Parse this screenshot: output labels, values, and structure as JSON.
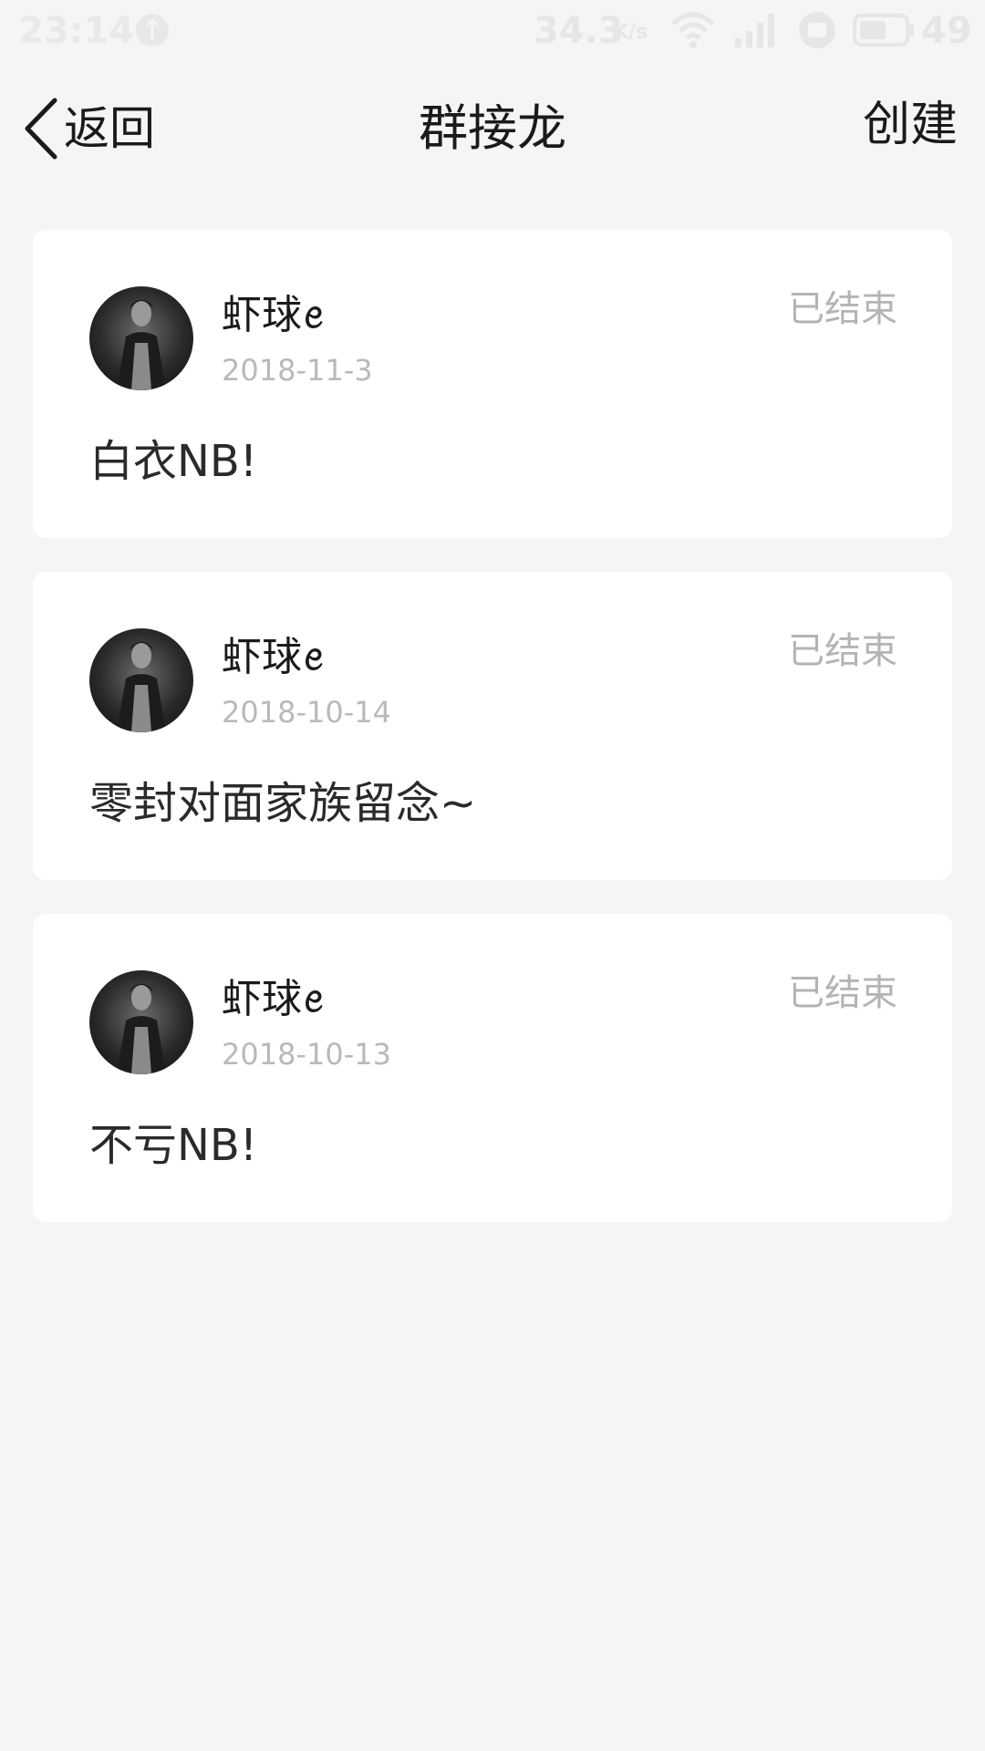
{
  "status_bar": {
    "time": "23:14",
    "network_speed": "34.3",
    "network_speed_unit": "K/s",
    "battery_level": "49",
    "icons": [
      "notification-icon",
      "wifi-icon",
      "signal-icon",
      "hd-icon",
      "battery-icon"
    ]
  },
  "nav": {
    "back_label": "返回",
    "title": "群接龙",
    "create_label": "创建"
  },
  "cards": [
    {
      "name": "虾球ꫀ",
      "date": "2018-11-3",
      "status": "已结束",
      "text": "白衣NB!"
    },
    {
      "name": "虾球ꫀ",
      "date": "2018-10-14",
      "status": "已结束",
      "text": "零封对面家族留念~"
    },
    {
      "name": "虾球ꫀ",
      "date": "2018-10-13",
      "status": "已结束",
      "text": "不亏NB!"
    }
  ],
  "colors": {
    "background": "#f5f5f7",
    "card": "#ffffff",
    "muted_text": "#b4b4b8",
    "primary_text": "#1a1a1a"
  }
}
